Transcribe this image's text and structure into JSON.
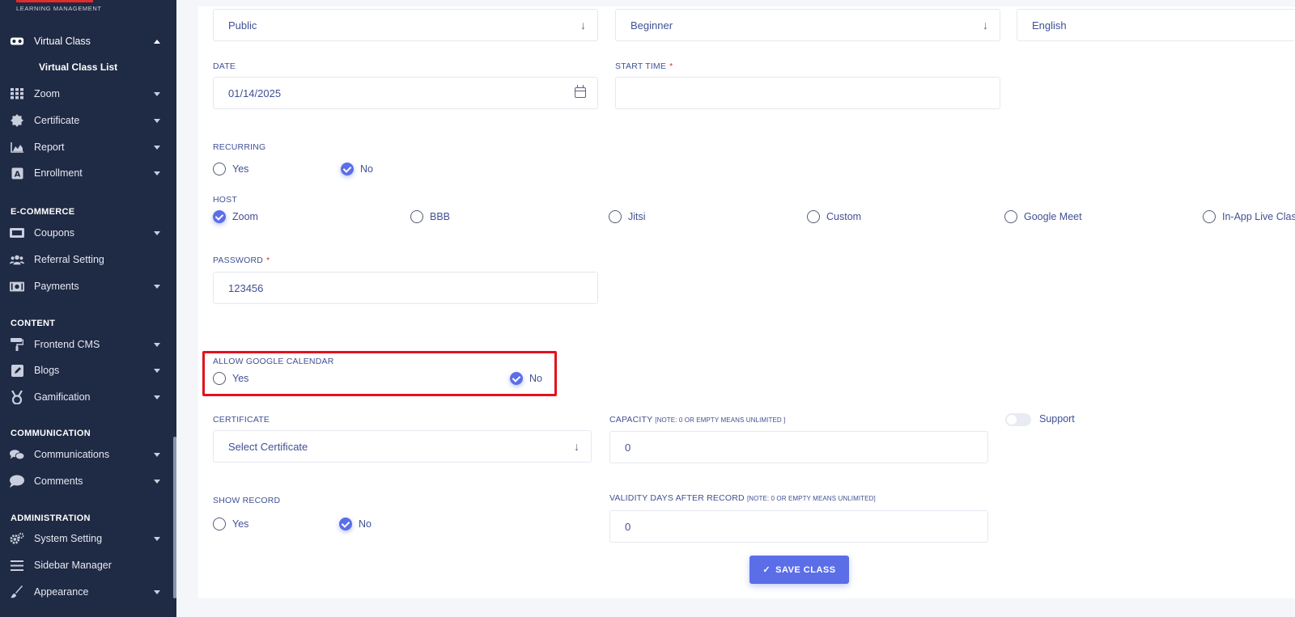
{
  "sidebar": {
    "brand_sub": "LEARNING MANAGEMENT",
    "items": [
      {
        "label": "Virtual Class",
        "icon": "vr-glasses-icon",
        "expanded": true
      },
      {
        "label": "Zoom",
        "icon": "grid-icon"
      },
      {
        "label": "Certificate",
        "icon": "certificate-icon"
      },
      {
        "label": "Report",
        "icon": "area-chart-icon"
      },
      {
        "label": "Enrollment",
        "icon": "enrollment-icon"
      },
      {
        "label": "Coupons",
        "icon": "coupon-icon"
      },
      {
        "label": "Referral Setting",
        "icon": "users-icon"
      },
      {
        "label": "Payments",
        "icon": "money-icon"
      },
      {
        "label": "Frontend CMS",
        "icon": "paint-roller-icon"
      },
      {
        "label": "Blogs",
        "icon": "edit-icon"
      },
      {
        "label": "Gamification",
        "icon": "medal-icon"
      },
      {
        "label": "Communications",
        "icon": "chat-icon"
      },
      {
        "label": "Comments",
        "icon": "comment-icon"
      },
      {
        "label": "System Setting",
        "icon": "gears-icon"
      },
      {
        "label": "Sidebar Manager",
        "icon": "bars-icon"
      },
      {
        "label": "Appearance",
        "icon": "brush-icon"
      }
    ],
    "sub_item": "Virtual Class List",
    "sections": [
      "E-COMMERCE",
      "CONTENT",
      "COMMUNICATION",
      "ADMINISTRATION"
    ]
  },
  "form": {
    "top_selects": [
      "Public",
      "Beginner",
      "English"
    ],
    "date_label": "DATE",
    "date_value": "01/14/2025",
    "start_time_label": "START TIME",
    "required_mark": "*",
    "recurring_label": "RECURRING",
    "yes": "Yes",
    "no": "No",
    "host_label": "HOST",
    "hosts": [
      "Zoom",
      "BBB",
      "Jitsi",
      "Custom",
      "Google Meet",
      "In-App Live Clas"
    ],
    "password_label": "PASSWORD",
    "password_value": "123456",
    "google_calendar_label": "ALLOW GOOGLE CALENDAR",
    "certificate_label": "CERTIFICATE",
    "certificate_placeholder": "Select Certificate",
    "capacity_label": "CAPACITY",
    "capacity_note": "[NOTE: 0 OR EMPTY MEANS UNLIMITED ]",
    "capacity_value": "0",
    "support_label": "Support",
    "show_record_label": "SHOW RECORD",
    "validity_label": "VALIDITY DAYS AFTER RECORD",
    "validity_note": "[NOTE: 0 OR EMPTY MEANS UNLIMITED]",
    "validity_value": "0",
    "save_label": "SAVE CLASS"
  },
  "colors": {
    "sidebar_bg": "#1f2a44",
    "accent": "#5b6ee8",
    "highlight": "#e3121d",
    "text": "#415094"
  }
}
